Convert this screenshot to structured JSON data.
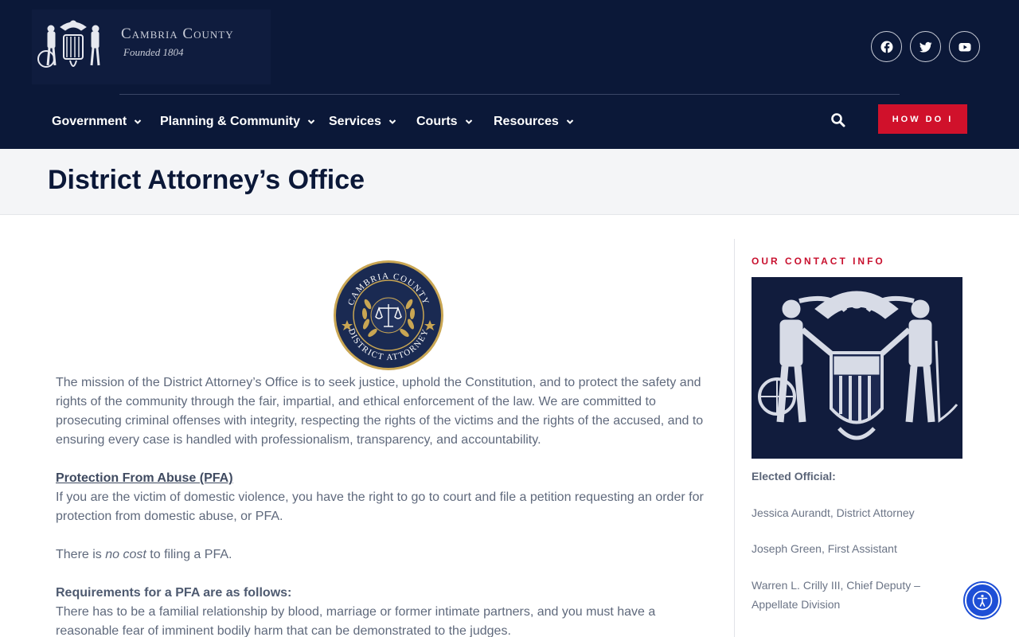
{
  "header": {
    "site_name": "Cambria County",
    "tagline": "Founded 1804",
    "social": [
      "facebook-icon",
      "twitter-icon",
      "youtube-icon"
    ],
    "nav": [
      "Government",
      "Planning & Community",
      "Services",
      "Courts",
      "Resources"
    ],
    "cta_label": "HOW DO I",
    "colors": {
      "navy": "#0b1838",
      "accent_red": "#d0112b"
    }
  },
  "page": {
    "title": "District Attorney’s Office"
  },
  "seal": {
    "top_text": "CAMBRIA COUNTY",
    "bottom_text": "DISTRICT ATTORNEY"
  },
  "content": {
    "mission": "The mission of the District Attorney’s Office is to seek justice, uphold the Constitution, and to protect the safety and rights of the community through the fair, impartial, and ethical enforcement of the law. We are committed to prosecuting criminal offenses with integrity, respecting the rights of the victims and the rights of the accused, and to ensuring every case is handled with professionalism, transparency, and accountability.",
    "pfa_heading": "Protection From Abuse (PFA)",
    "pfa_text": "If you are the victim of domestic violence, you have the right to go to court and file a petition requesting an order for protection from domestic abuse, or PFA.",
    "cost_before": "There is ",
    "cost_em": "no cost",
    "cost_after": " to filing a PFA.",
    "req_heading": "Requirements for a PFA are as follows:",
    "req_text": "There has to be a familial relationship by blood, marriage or former intimate partners, and you must have a reasonable fear of imminent bodily harm that can be demonstrated to the judges."
  },
  "sidebar": {
    "heading": "OUR CONTACT INFO",
    "elected_label": "Elected Official:",
    "officials": [
      "Jessica Aurandt, District Attorney",
      "Joseph Green, First Assistant",
      "Warren L. Crilly III, Chief Deputy – Appellate Division"
    ]
  },
  "accessibility_button": "accessibility-icon"
}
